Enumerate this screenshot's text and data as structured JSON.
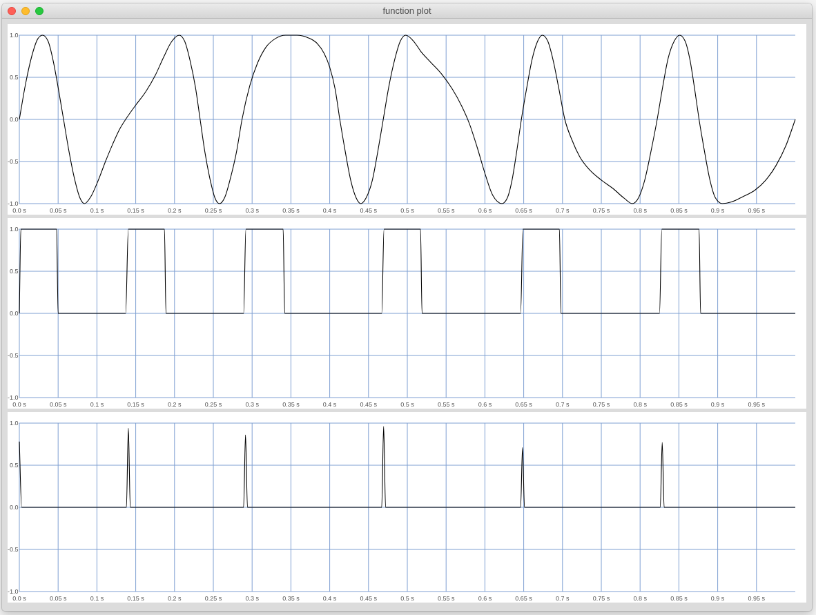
{
  "window": {
    "title": "function plot"
  },
  "plots": [
    {
      "chart_data": {
        "type": "line",
        "grid": true,
        "x": [
          0,
          0.008,
          0.016,
          0.024,
          0.03,
          0.037,
          0.044,
          0.05,
          0.057,
          0.064,
          0.071,
          0.078,
          0.084,
          0.092,
          0.101,
          0.111,
          0.12,
          0.129,
          0.137,
          0.15,
          0.163,
          0.175,
          0.186,
          0.196,
          0.206,
          0.213,
          0.22,
          0.227,
          0.233,
          0.239,
          0.246,
          0.252,
          0.258,
          0.265,
          0.272,
          0.28,
          0.287,
          0.297,
          0.307,
          0.318,
          0.33,
          0.343,
          0.358,
          0.372,
          0.384,
          0.393,
          0.4,
          0.407,
          0.413,
          0.42,
          0.427,
          0.434,
          0.44,
          0.447,
          0.455,
          0.462,
          0.469,
          0.476,
          0.484,
          0.491,
          0.498,
          0.508,
          0.518,
          0.53,
          0.545,
          0.558,
          0.57,
          0.58,
          0.59,
          0.6,
          0.61,
          0.622,
          0.629,
          0.635,
          0.641,
          0.647,
          0.654,
          0.661,
          0.668,
          0.674,
          0.681,
          0.688,
          0.695,
          0.703,
          0.712,
          0.722,
          0.735,
          0.75,
          0.765,
          0.78,
          0.79,
          0.798,
          0.806,
          0.814,
          0.822,
          0.829,
          0.836,
          0.844,
          0.851,
          0.858,
          0.864,
          0.87,
          0.876,
          0.883,
          0.89,
          0.897,
          0.906,
          0.918,
          0.932,
          0.948,
          0.962,
          0.975,
          0.988,
          1
        ],
        "series": [
          {
            "color": "#000000",
            "values": [
              0,
              0.42,
              0.75,
              0.96,
              1,
              0.93,
              0.68,
              0.38,
              0,
              -0.38,
              -0.7,
              -0.93,
              -1,
              -0.92,
              -0.74,
              -0.5,
              -0.3,
              -0.12,
              0,
              0.17,
              0.33,
              0.52,
              0.74,
              0.92,
              1,
              0.93,
              0.7,
              0.38,
              0,
              -0.38,
              -0.72,
              -0.93,
              -1,
              -0.92,
              -0.7,
              -0.38,
              0,
              0.4,
              0.67,
              0.86,
              0.96,
              1,
              1,
              0.97,
              0.9,
              0.78,
              0.62,
              0.36,
              0,
              -0.38,
              -0.72,
              -0.93,
              -1,
              -0.93,
              -0.72,
              -0.38,
              0,
              0.38,
              0.72,
              0.93,
              1,
              0.93,
              0.8,
              0.68,
              0.53,
              0.36,
              0.16,
              -0.05,
              -0.33,
              -0.64,
              -0.9,
              -1,
              -0.93,
              -0.72,
              -0.38,
              0,
              0.38,
              0.72,
              0.93,
              1,
              0.93,
              0.7,
              0.38,
              0,
              -0.24,
              -0.44,
              -0.6,
              -0.72,
              -0.82,
              -0.94,
              -1,
              -0.93,
              -0.72,
              -0.38,
              0,
              0.38,
              0.72,
              0.93,
              1,
              0.93,
              0.72,
              0.38,
              0,
              -0.38,
              -0.72,
              -0.93,
              -1,
              -0.98,
              -0.92,
              -0.84,
              -0.72,
              -0.55,
              -0.31,
              0
            ]
          }
        ],
        "xlim": [
          0,
          1
        ],
        "ylim": [
          -1,
          1
        ],
        "xticks": [
          {
            "value": 0,
            "label": "0.0 s"
          },
          {
            "value": 0.05,
            "label": "0.05 s"
          },
          {
            "value": 0.1,
            "label": "0.1 s"
          },
          {
            "value": 0.15,
            "label": "0.15 s"
          },
          {
            "value": 0.2,
            "label": "0.2 s"
          },
          {
            "value": 0.25,
            "label": "0.25 s"
          },
          {
            "value": 0.3,
            "label": "0.3 s"
          },
          {
            "value": 0.35,
            "label": "0.35 s"
          },
          {
            "value": 0.4,
            "label": "0.4 s"
          },
          {
            "value": 0.45,
            "label": "0.45 s"
          },
          {
            "value": 0.5,
            "label": "0.5 s"
          },
          {
            "value": 0.55,
            "label": "0.55 s"
          },
          {
            "value": 0.6,
            "label": "0.6 s"
          },
          {
            "value": 0.65,
            "label": "0.65 s"
          },
          {
            "value": 0.7,
            "label": "0.7 s"
          },
          {
            "value": 0.75,
            "label": "0.75 s"
          },
          {
            "value": 0.8,
            "label": "0.8 s"
          },
          {
            "value": 0.85,
            "label": "0.85 s"
          },
          {
            "value": 0.9,
            "label": "0.9 s"
          },
          {
            "value": 0.95,
            "label": "0.95 s"
          }
        ],
        "yticks": [
          {
            "value": -1,
            "label": "-1.0"
          },
          {
            "value": -0.5,
            "label": "-0.5"
          },
          {
            "value": 0,
            "label": "0.0"
          },
          {
            "value": 0.5,
            "label": "0.5"
          },
          {
            "value": 1,
            "label": "1.0"
          }
        ]
      }
    },
    {
      "chart_data": {
        "type": "line",
        "grid": true,
        "x": [
          0,
          0.002,
          0.048,
          0.05,
          0.137,
          0.1405,
          0.187,
          0.189,
          0.289,
          0.292,
          0.34,
          0.342,
          0.467,
          0.47,
          0.517,
          0.519,
          0.646,
          0.649,
          0.696,
          0.698,
          0.825,
          0.828,
          0.876,
          0.878,
          1
        ],
        "series": [
          {
            "color": "#000000",
            "values": [
              0,
              1,
              1,
              0,
              0,
              1,
              1,
              0,
              0,
              1,
              1,
              0,
              0,
              1,
              1,
              0,
              0,
              1,
              1,
              0,
              0,
              1,
              1,
              0,
              0
            ]
          }
        ],
        "xlim": [
          0,
          1
        ],
        "ylim": [
          -1,
          1
        ],
        "xticks": [
          {
            "value": 0,
            "label": "0.0 s"
          },
          {
            "value": 0.05,
            "label": "0.05 s"
          },
          {
            "value": 0.1,
            "label": "0.1 s"
          },
          {
            "value": 0.15,
            "label": "0.15 s"
          },
          {
            "value": 0.2,
            "label": "0.2 s"
          },
          {
            "value": 0.25,
            "label": "0.25 s"
          },
          {
            "value": 0.3,
            "label": "0.3 s"
          },
          {
            "value": 0.35,
            "label": "0.35 s"
          },
          {
            "value": 0.4,
            "label": "0.4 s"
          },
          {
            "value": 0.45,
            "label": "0.45 s"
          },
          {
            "value": 0.5,
            "label": "0.5 s"
          },
          {
            "value": 0.55,
            "label": "0.55 s"
          },
          {
            "value": 0.6,
            "label": "0.6 s"
          },
          {
            "value": 0.65,
            "label": "0.65 s"
          },
          {
            "value": 0.7,
            "label": "0.7 s"
          },
          {
            "value": 0.75,
            "label": "0.75 s"
          },
          {
            "value": 0.8,
            "label": "0.8 s"
          },
          {
            "value": 0.85,
            "label": "0.85 s"
          },
          {
            "value": 0.9,
            "label": "0.9 s"
          },
          {
            "value": 0.95,
            "label": "0.95 s"
          }
        ],
        "yticks": [
          {
            "value": -1,
            "label": "-1.0"
          },
          {
            "value": -0.5,
            "label": "-0.5"
          },
          {
            "value": 0,
            "label": "0.0"
          },
          {
            "value": 0.5,
            "label": "0.5"
          },
          {
            "value": 1,
            "label": "1.0"
          }
        ]
      }
    },
    {
      "chart_data": {
        "type": "line",
        "grid": true,
        "x": [
          0,
          0.003,
          0.138,
          0.1405,
          0.143,
          0.289,
          0.2915,
          0.294,
          0.467,
          0.4695,
          0.472,
          0.646,
          0.6485,
          0.651,
          0.826,
          0.8285,
          0.831,
          1
        ],
        "series": [
          {
            "color": "#000000",
            "values": [
              0.78,
              0,
              0,
              0.94,
              0,
              0,
              0.86,
              0,
              0,
              0.96,
              0,
              0,
              0.71,
              0,
              0,
              0.77,
              0,
              0
            ]
          }
        ],
        "xlim": [
          0,
          1
        ],
        "ylim": [
          -1,
          1
        ],
        "xticks": [
          {
            "value": 0,
            "label": "0.0 s"
          },
          {
            "value": 0.05,
            "label": "0.05 s"
          },
          {
            "value": 0.1,
            "label": "0.1 s"
          },
          {
            "value": 0.15,
            "label": "0.15 s"
          },
          {
            "value": 0.2,
            "label": "0.2 s"
          },
          {
            "value": 0.25,
            "label": "0.25 s"
          },
          {
            "value": 0.3,
            "label": "0.3 s"
          },
          {
            "value": 0.35,
            "label": "0.35 s"
          },
          {
            "value": 0.4,
            "label": "0.4 s"
          },
          {
            "value": 0.45,
            "label": "0.45 s"
          },
          {
            "value": 0.5,
            "label": "0.5 s"
          },
          {
            "value": 0.55,
            "label": "0.55 s"
          },
          {
            "value": 0.6,
            "label": "0.6 s"
          },
          {
            "value": 0.65,
            "label": "0.65 s"
          },
          {
            "value": 0.7,
            "label": "0.7 s"
          },
          {
            "value": 0.75,
            "label": "0.75 s"
          },
          {
            "value": 0.8,
            "label": "0.8 s"
          },
          {
            "value": 0.85,
            "label": "0.85 s"
          },
          {
            "value": 0.9,
            "label": "0.9 s"
          },
          {
            "value": 0.95,
            "label": "0.95 s"
          }
        ],
        "yticks": [
          {
            "value": -1,
            "label": "-1.0"
          },
          {
            "value": -0.5,
            "label": "-0.5"
          },
          {
            "value": 0,
            "label": "0.0"
          },
          {
            "value": 0.5,
            "label": "0.5"
          },
          {
            "value": 1,
            "label": "1.0"
          }
        ]
      }
    }
  ]
}
